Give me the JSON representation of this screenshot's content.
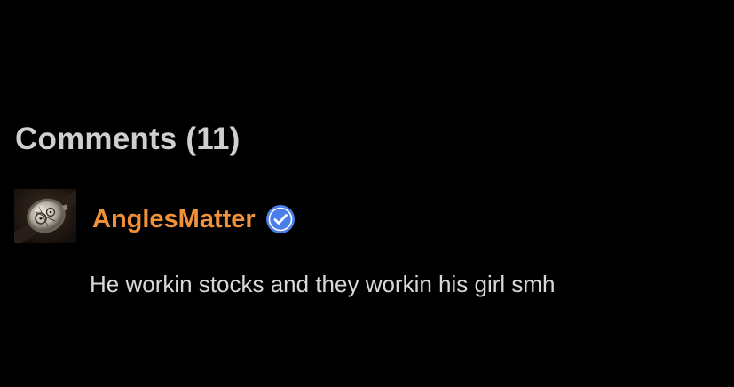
{
  "comments": {
    "title": "Comments (11)"
  },
  "comment": {
    "username": "AnglesMatter",
    "verified": true,
    "verified_icon": "verified-check-icon",
    "avatar_icon": "watch-avatar",
    "body": "He workin stocks and they workin his girl smh"
  },
  "colors": {
    "background": "#000000",
    "title": "#cfcfcf",
    "username": "#f0923a",
    "verified_badge": "#4a7ee8",
    "body_text": "#d8d8d8"
  }
}
